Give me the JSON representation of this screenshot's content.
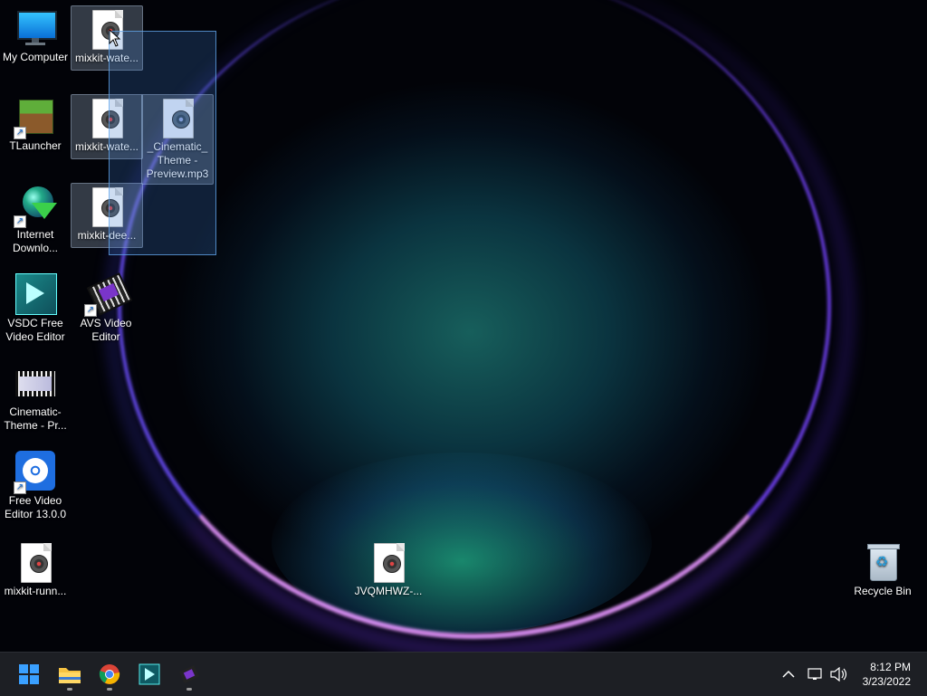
{
  "desktop": {
    "icons": [
      {
        "id": "my-computer",
        "label": "My Computer"
      },
      {
        "id": "mixkit-1",
        "label": "mixkit-wate..."
      },
      {
        "id": "tlauncher",
        "label": "TLauncher"
      },
      {
        "id": "mixkit-2",
        "label": "mixkit-wate..."
      },
      {
        "id": "cinematic-preview",
        "label": "_Cinematic_ Theme - Preview.mp3"
      },
      {
        "id": "idm",
        "label": "Internet Downlo..."
      },
      {
        "id": "mixkit-3",
        "label": "mixkit-dee..."
      },
      {
        "id": "vsdc",
        "label": "VSDC Free Video Editor"
      },
      {
        "id": "avs",
        "label": "AVS Video Editor"
      },
      {
        "id": "cinematic-theme",
        "label": "Cinematic- Theme - Pr..."
      },
      {
        "id": "free-video-editor",
        "label": "Free Video Editor 13.0.0"
      },
      {
        "id": "mixkit-runn",
        "label": "mixkit-runn..."
      },
      {
        "id": "jvqmhwz",
        "label": "JVQMHWZ-..."
      },
      {
        "id": "recycle-bin",
        "label": "Recycle Bin"
      }
    ]
  },
  "taskbar": {
    "time": "8:12 PM",
    "date": "3/23/2022",
    "apps": [
      "start",
      "file-explorer",
      "chrome",
      "vsdc",
      "avs"
    ]
  }
}
